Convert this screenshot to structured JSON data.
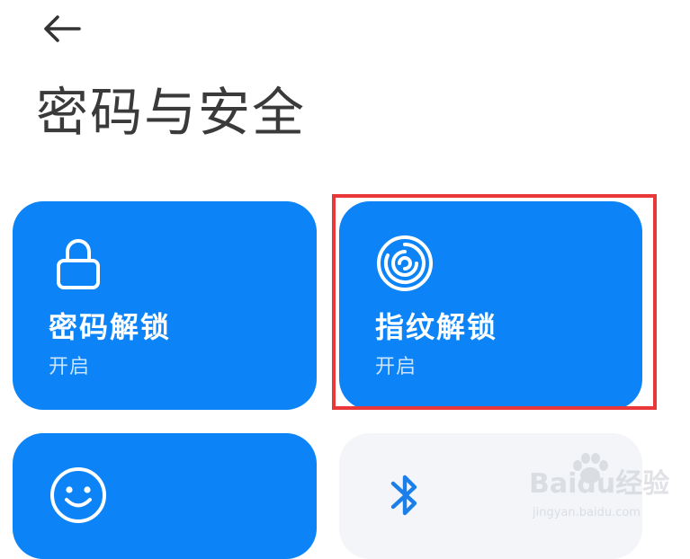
{
  "header": {
    "title": "密码与安全"
  },
  "cards": [
    {
      "title": "密码解锁",
      "status": "开启",
      "icon": "lock-icon",
      "color": "#0c84f8"
    },
    {
      "title": "指纹解锁",
      "status": "开启",
      "icon": "fingerprint-icon",
      "color": "#0c84f8"
    },
    {
      "title": "",
      "status": "",
      "icon": "smiley-face-icon",
      "color": "#0c84f8"
    },
    {
      "title": "",
      "status": "",
      "icon": "bluetooth-icon",
      "color": "#f3f5f8"
    }
  ],
  "highlight_color": "#e8383a",
  "watermark": {
    "brand": "Baidu经验",
    "url": "jingyan.baidu.com"
  }
}
